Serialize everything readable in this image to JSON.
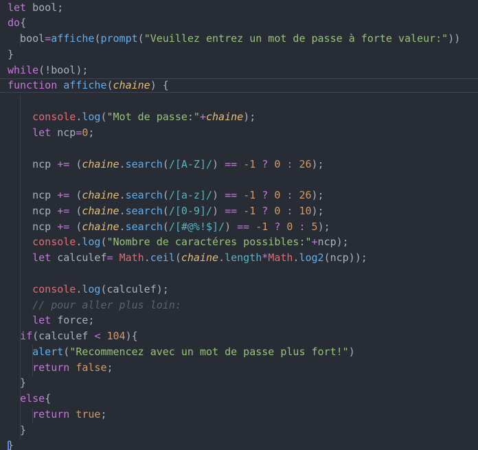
{
  "theme": {
    "background": "#282c34",
    "keyword": "#c678dd",
    "function": "#61afef",
    "string": "#98c379",
    "number": "#d19a66",
    "parameter": "#e5c07b",
    "regex": "#56b6c2",
    "comment": "#5c6370",
    "text": "#abb2bf"
  },
  "code": {
    "l1": {
      "a": "let",
      "b": " bool;"
    },
    "l2": {
      "a": "do",
      "b": "{"
    },
    "l3": {
      "a": "  bool",
      "b": "=",
      "c": "affiche",
      "d": "(",
      "e": "prompt",
      "f": "(",
      "g": "\"Veuillez entrez un mot de passe à forte valeur:\"",
      "h": "))"
    },
    "l4": {
      "a": "}"
    },
    "l5": {
      "a": "while",
      "b": "(!bool);"
    },
    "l6": {
      "a": "function",
      "b": " ",
      "c": "affiche",
      "d": "(",
      "e": "chaine",
      "f": ") {"
    },
    "l8": {
      "a": "    console",
      "b": ".",
      "c": "log",
      "d": "(",
      "e": "\"Mot de passe:\"",
      "f": "+",
      "g": "chaine",
      "h": ");"
    },
    "l9": {
      "a": "    ",
      "b": "let",
      "c": " ncp",
      "d": "=",
      "e": "0",
      "f": ";"
    },
    "l11": {
      "a": "    ncp ",
      "b": "+=",
      "c": " (",
      "d": "chaine",
      "e": ".",
      "f": "search",
      "g": "(",
      "h": "/[A-Z]/",
      "i": ") ",
      "j": "==",
      "k": " ",
      "l": "-1",
      "m": " ",
      "n": "?",
      "o": " ",
      "p": "0",
      "q": " ",
      "r": ":",
      "s": " ",
      "t": "26",
      "u": ");"
    },
    "l13": {
      "a": "    ncp ",
      "b": "+=",
      "c": " (",
      "d": "chaine",
      "e": ".",
      "f": "search",
      "g": "(",
      "h": "/[a-z]/",
      "i": ") ",
      "j": "==",
      "k": " ",
      "l": "-1",
      "m": " ",
      "n": "?",
      "o": " ",
      "p": "0",
      "q": " ",
      "r": ":",
      "s": " ",
      "t": "26",
      "u": ");"
    },
    "l14": {
      "a": "    ncp ",
      "b": "+=",
      "c": " (",
      "d": "chaine",
      "e": ".",
      "f": "search",
      "g": "(",
      "h": "/[0-9]/",
      "i": ") ",
      "j": "==",
      "k": " ",
      "l": "-1",
      "m": " ",
      "n": "?",
      "o": " ",
      "p": "0",
      "q": " ",
      "r": ":",
      "s": " ",
      "t": "10",
      "u": ");"
    },
    "l15": {
      "a": "    ncp ",
      "b": "+=",
      "c": " (",
      "d": "chaine",
      "e": ".",
      "f": "search",
      "g": "(",
      "h": "/[#@%!$]/",
      "i": ") ",
      "j": "==",
      "k": " ",
      "l": "-1",
      "m": " ",
      "n": "?",
      "o": " ",
      "p": "0",
      "q": " ",
      "r": ":",
      "s": " ",
      "t": "5",
      "u": ");"
    },
    "l16": {
      "a": "    console",
      "b": ".",
      "c": "log",
      "d": "(",
      "e": "\"Nombre de caractéres possibles:\"",
      "f": "+",
      "g": "ncp);"
    },
    "l17": {
      "a": "    ",
      "b": "let",
      "c": " calculef",
      "d": "=",
      "e": " ",
      "f": "Math",
      "g": ".",
      "h": "ceil",
      "i": "(",
      "j": "chaine",
      "k": ".",
      "l": "length",
      "m": "*",
      "n": "Math",
      "o": ".",
      "p": "log2",
      "q": "(ncp));"
    },
    "l19": {
      "a": "    console",
      "b": ".",
      "c": "log",
      "d": "(calculef);"
    },
    "l20": {
      "a": "    // pour aller plus loin:"
    },
    "l21": {
      "a": "    ",
      "b": "let",
      "c": " force;"
    },
    "l22": {
      "a": "  ",
      "b": "if",
      "c": "(calculef ",
      "d": "<",
      "e": " ",
      "f": "104",
      "g": "){"
    },
    "l23": {
      "a": "    ",
      "b": "alert",
      "c": "(",
      "d": "\"Recommencez avec un mot de passe plus fort!\"",
      "e": ")"
    },
    "l24": {
      "a": "    ",
      "b": "return",
      "c": " ",
      "d": "false",
      "e": ";"
    },
    "l25": {
      "a": "  }"
    },
    "l26": {
      "a": "  ",
      "b": "else",
      "c": "{"
    },
    "l27": {
      "a": "    ",
      "b": "return",
      "c": " ",
      "d": "true",
      "e": ";"
    },
    "l28": {
      "a": "  }"
    },
    "l29": {
      "a": "}"
    }
  }
}
